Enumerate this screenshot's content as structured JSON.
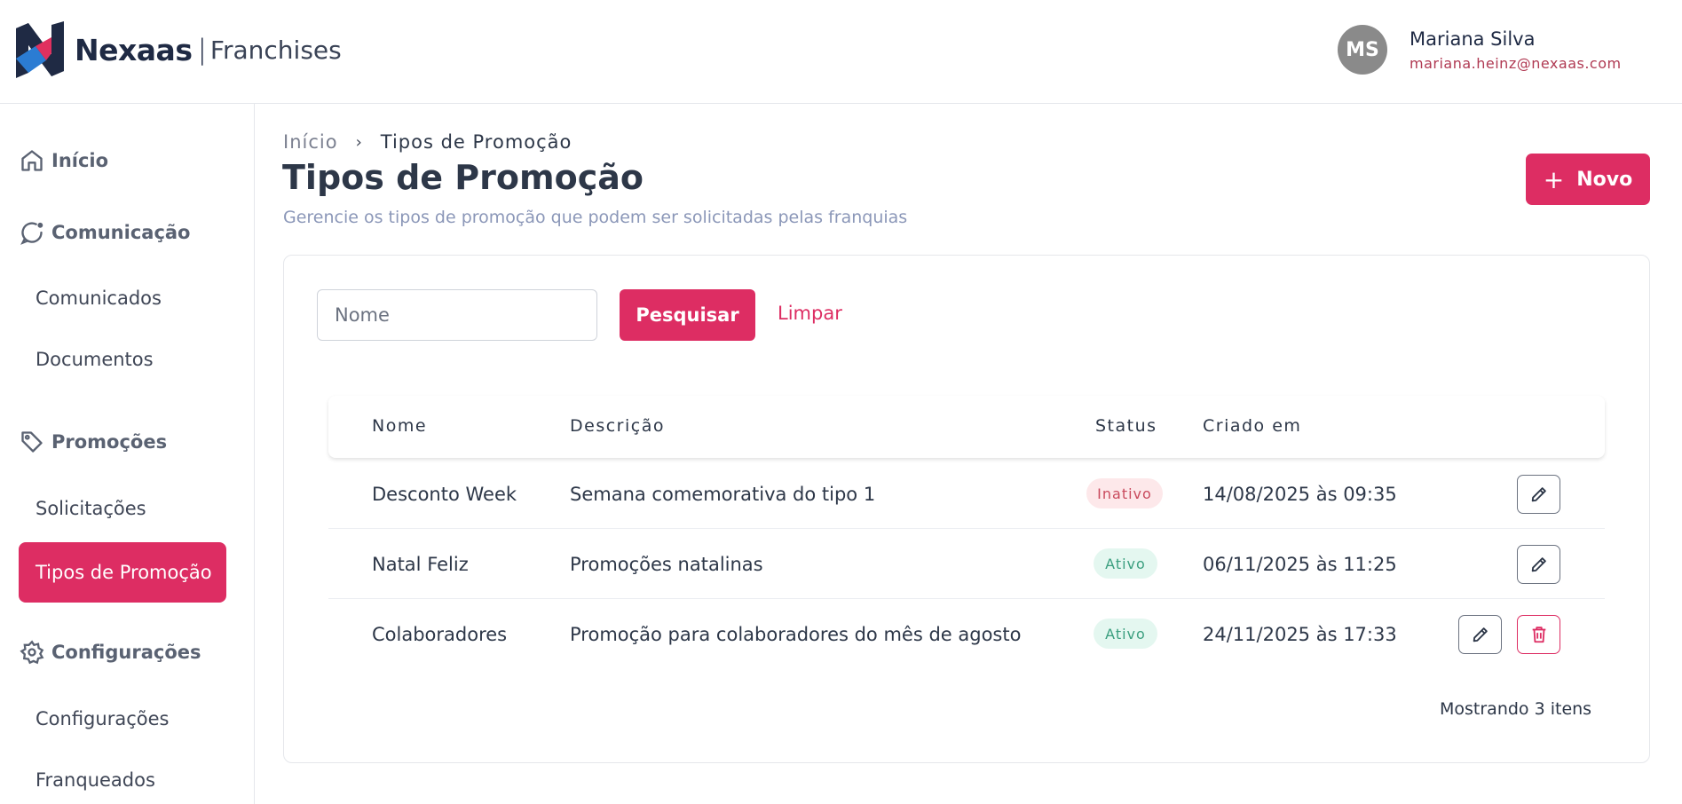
{
  "header": {
    "brand": "Nexaas",
    "brand_sep": "|",
    "brand_sub": "Franchises",
    "user": {
      "initials": "MS",
      "name": "Mariana Silva",
      "email": "mariana.heinz@nexaas.com"
    }
  },
  "sidebar": {
    "groups": [
      {
        "label": "Início",
        "icon": "home-icon"
      },
      {
        "label": "Comunicação",
        "icon": "chat-icon",
        "items": [
          "Comunicados",
          "Documentos"
        ]
      },
      {
        "label": "Promoções",
        "icon": "tag-icon",
        "items": [
          "Solicitações",
          "Tipos de Promoção"
        ]
      },
      {
        "label": "Configurações",
        "icon": "gear-icon",
        "items": [
          "Configurações",
          "Franqueados"
        ]
      }
    ],
    "active": "Tipos de Promoção"
  },
  "breadcrumb": {
    "home": "Início",
    "separator": "›",
    "current": "Tipos de Promoção"
  },
  "page": {
    "title": "Tipos de Promoção",
    "subtitle": "Gerencie os tipos de promoção que podem ser solicitadas pelas franquias",
    "new_button": "Novo",
    "new_icon": "+"
  },
  "search": {
    "placeholder": "Nome",
    "value": "",
    "search_button": "Pesquisar",
    "clear_link": "Limpar"
  },
  "table": {
    "columns": [
      "Nome",
      "Descrição",
      "Status",
      "Criado em"
    ],
    "rows": [
      {
        "name": "Desconto Week",
        "description": "Semana comemorativa do tipo 1",
        "status": "Inativo",
        "created": "14/08/2025 às 09:35",
        "actions": [
          "edit"
        ]
      },
      {
        "name": "Natal Feliz",
        "description": "Promoções natalinas",
        "status": "Ativo",
        "created": "06/11/2025 às 11:25",
        "actions": [
          "edit"
        ]
      },
      {
        "name": "Colaboradores",
        "description": "Promoção para colaboradores do mês de agosto",
        "status": "Ativo",
        "created": "24/11/2025 às 17:33",
        "actions": [
          "edit",
          "delete"
        ]
      }
    ],
    "footer": "Mostrando 3 itens"
  },
  "colors": {
    "accent": "#dd2d63",
    "text": "#2d3748",
    "muted": "#8b97b8"
  }
}
